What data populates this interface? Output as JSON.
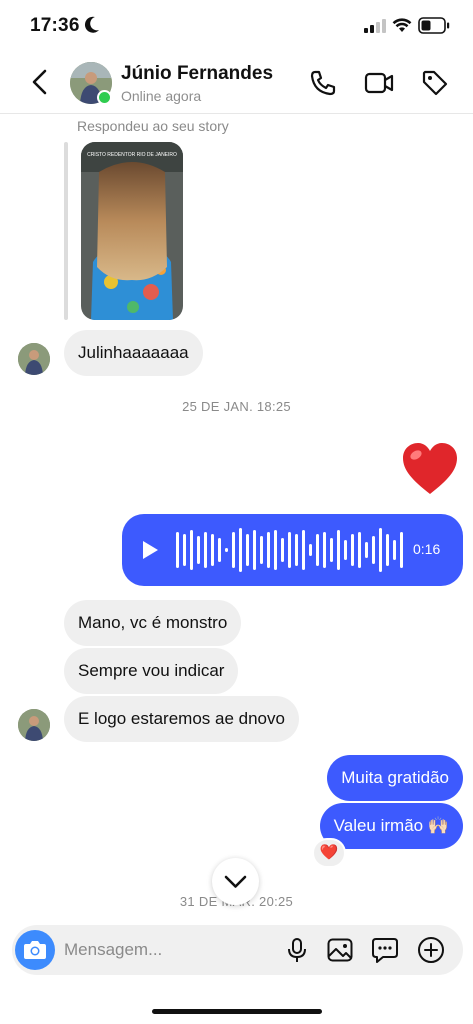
{
  "status_bar": {
    "time": "17:36"
  },
  "header": {
    "contact_name": "Júnio Fernandes",
    "contact_status": "Online agora"
  },
  "story_reply": {
    "label": "Respondeu ao seu story",
    "story_overlay_text": "CRISTO REDENTOR RIO DE JANEIRO"
  },
  "messages": {
    "m1": "Julinhaaaaaaa",
    "date1": "25 DE JAN. 18:25",
    "heart_emoji": "❤️",
    "audio_duration": "0:16",
    "m2": "Mano, vc é monstro",
    "m3": "Sempre vou indicar",
    "m4": "E logo estaremos ae dnovo",
    "m5": "Muita gratidão",
    "m6": "Valeu irmão 🙌🏻",
    "reaction": "❤️",
    "date2": "31 DE MAR. 20:25"
  },
  "composer": {
    "placeholder": "Mensagem..."
  },
  "colors": {
    "outgoing_bubble": "#3d5afe",
    "incoming_bubble": "#efefef",
    "online_dot": "#2fcc4f",
    "camera_button": "#3d8bfd"
  },
  "icons": [
    "moon-icon",
    "signal-icon",
    "wifi-icon",
    "battery-icon",
    "back-icon",
    "phone-icon",
    "video-icon",
    "tag-icon",
    "play-icon",
    "chevron-down-icon",
    "camera-icon",
    "microphone-icon",
    "gallery-icon",
    "sticker-icon",
    "plus-icon"
  ]
}
